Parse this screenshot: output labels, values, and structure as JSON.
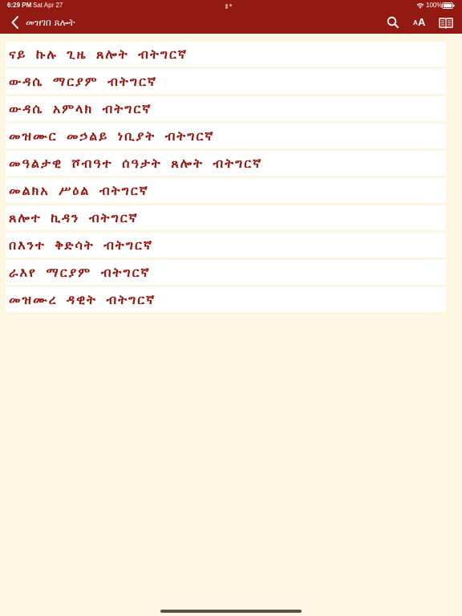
{
  "status_bar": {
    "time": "6:29 PM",
    "date": "Sat Apr 27",
    "battery_percent": "100%"
  },
  "nav": {
    "title": "መዝገበ ጸሎት",
    "back_icon": "chevron-left-icon",
    "tools": [
      "search-icon",
      "font-size-icon",
      "book-icon"
    ]
  },
  "prayers": [
    {
      "title": "ናይ ኩሉ ጊዜ ጸሎት ብትግርኛ"
    },
    {
      "title": "ውዳሴ ማርያም ብትግርኛ"
    },
    {
      "title": "ውዳሴ አምላክ ብትግርኛ"
    },
    {
      "title": "መዝሙር መኃልይ ነቢያት ብትግርኛ"
    },
    {
      "title": "መዓልታዊ ሾብዓተ ሰዓታት ጸሎት ብትግርኛ"
    },
    {
      "title": "መልክአ ሥዕል ብትግርኛ"
    },
    {
      "title": "ጸሎተ ኪዳን ብትግርኛ"
    },
    {
      "title": "በእንተ ቅድሳት ብትግርኛ"
    },
    {
      "title": "ራእየ ማርያም ብትግርኛ"
    },
    {
      "title": "መዝሙረ ዳዊት ብትግርኛ"
    }
  ],
  "colors": {
    "header": "#931a12",
    "accent_text": "#931a12",
    "background": "#fcf6e2",
    "row": "#ffffff"
  }
}
